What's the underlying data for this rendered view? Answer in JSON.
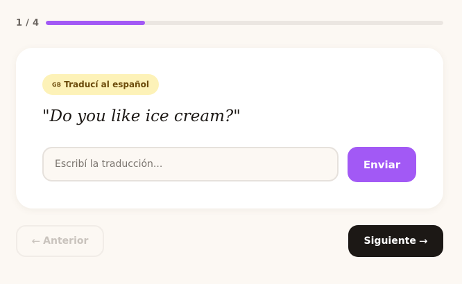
{
  "progress": {
    "label": "1 / 4",
    "current": 1,
    "total": 4,
    "fraction": 0.25,
    "fill_color": "#a259f5"
  },
  "card": {
    "badge": {
      "flag": "GB",
      "label": "Traducí al español",
      "background": "#fdf2b8"
    },
    "prompt": "\"Do you like ice cream?\"",
    "answer": {
      "value": "",
      "placeholder": "Escribí la traducción..."
    },
    "submit_label": "Enviar"
  },
  "navigation": {
    "prev": {
      "arrow": "←",
      "label": "Anterior",
      "icon": "arrow-left-icon",
      "disabled": true
    },
    "next": {
      "label": "Siguiente",
      "arrow": "→",
      "icon": "arrow-right-icon"
    }
  },
  "colors": {
    "background": "#fcf8f3",
    "accent": "#a259f5",
    "dark": "#1c1815"
  }
}
